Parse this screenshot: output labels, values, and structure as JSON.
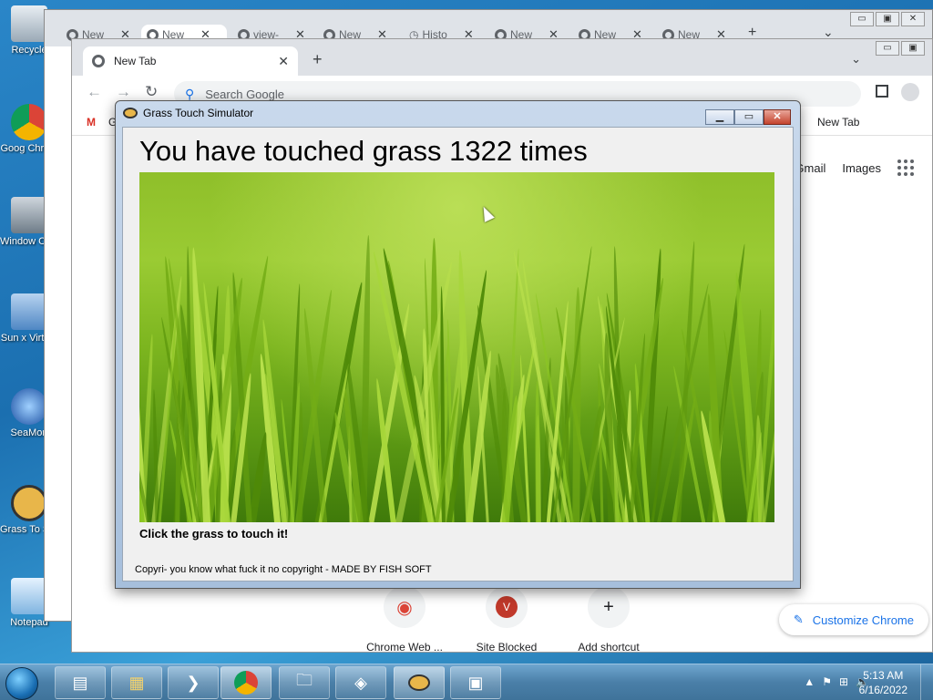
{
  "desktop": {
    "icons": [
      {
        "label": "Recycle",
        "icon": "recycle-bin-icon"
      },
      {
        "label": "Goog Chrom",
        "icon": "chrome-icon"
      },
      {
        "label": "Window Conso",
        "icon": "windows-console-icon"
      },
      {
        "label": "Sun x Virtual",
        "icon": "virtualbox-icon"
      },
      {
        "label": "SeaMon",
        "icon": "seamonkey-icon"
      },
      {
        "label": "Grass To Simula",
        "icon": "nerd-glasses-icon"
      },
      {
        "label": "Notepad",
        "icon": "notepad-icon"
      }
    ]
  },
  "chrome_back": {
    "tabs": [
      "New",
      "New",
      "view-",
      "New",
      "Histo",
      "New",
      "New",
      "New"
    ],
    "new_tab": "+",
    "dropdown": "⌄",
    "controls": {
      "min": "▭",
      "max": "▣",
      "close": "✕"
    }
  },
  "chrome_front": {
    "tab_title": "New Tab",
    "tab_close": "✕",
    "new_tab": "+",
    "dropdown": "⌄",
    "controls": {
      "min": "▭",
      "max": "▣"
    },
    "nav": {
      "back": "←",
      "forward": "→",
      "reload": "↻"
    },
    "omnibox_placeholder": "Search Google",
    "bookmark_gmail": "G",
    "bookmark_newtab": "New Tab",
    "ntp": {
      "gmail": "Gmail",
      "images": "Images"
    },
    "shortcuts": [
      {
        "label": "Chrome Web ...",
        "glyph": "◉"
      },
      {
        "label": "Site Blocked",
        "glyph": "V"
      },
      {
        "label": "Add shortcut",
        "glyph": "+"
      }
    ],
    "customize": "Customize Chrome"
  },
  "grass_app": {
    "title": "Grass Touch Simulator",
    "counter_text": "You have touched grass 1322 times",
    "hint": "Click the grass to touch it!",
    "copyright": "Copyri- you know what fuck it no copyright - MADE BY FISH SOFT",
    "controls": {
      "min": "▁",
      "max": "▭",
      "close": "✕"
    }
  },
  "taskbar": {
    "time": "5:13 AM",
    "date": "6/16/2022",
    "buttons": [
      "file-manager-icon",
      "explorer-icon",
      "powershell-icon",
      "chrome-icon",
      "folder-icon",
      "virtualbox-icon",
      "nerd-glasses-icon",
      "network-icon"
    ]
  },
  "colors": {
    "accent": "#1a73e8",
    "grass": "#7cb51f"
  }
}
